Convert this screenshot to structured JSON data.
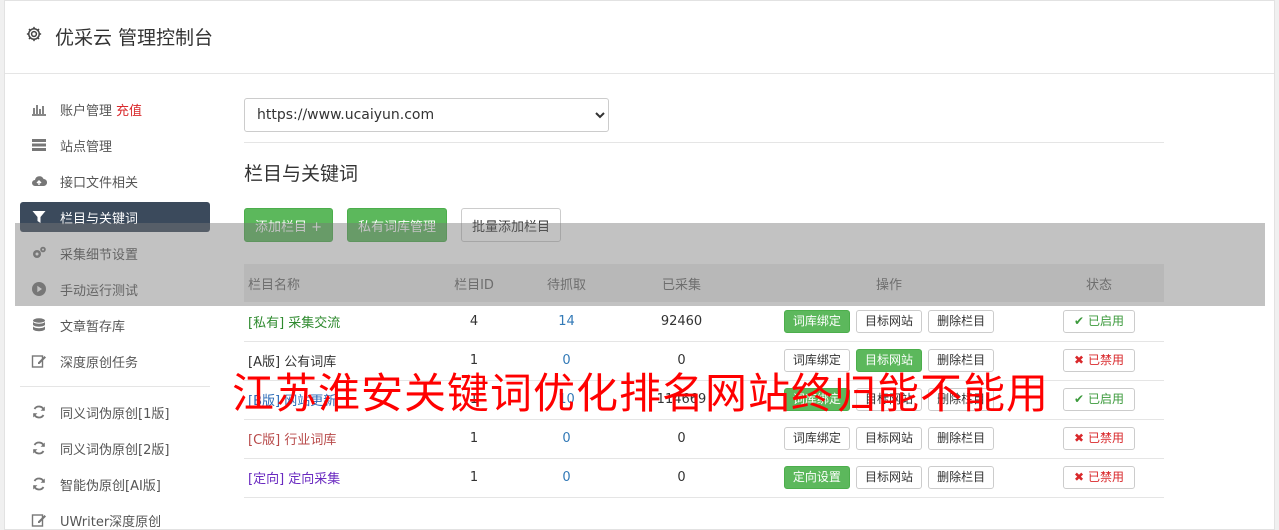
{
  "header": {
    "title": "优采云 管理控制台"
  },
  "sidebar": {
    "items": [
      {
        "label": "账户管理",
        "extra": "充值",
        "icon": "bar-chart-icon"
      },
      {
        "label": "站点管理",
        "icon": "server-icon"
      },
      {
        "label": "接口文件相关",
        "icon": "cloud-upload-icon"
      },
      {
        "label": "栏目与关键词",
        "icon": "filter-icon",
        "active": true
      },
      {
        "label": "采集细节设置",
        "icon": "cogs-icon"
      },
      {
        "label": "手动运行测试",
        "icon": "play-icon"
      },
      {
        "label": "文章暂存库",
        "icon": "database-icon"
      },
      {
        "label": "深度原创任务",
        "icon": "edit-icon"
      }
    ],
    "items2": [
      {
        "label": "同义词伪原创[1版]",
        "icon": "refresh-icon"
      },
      {
        "label": "同义词伪原创[2版]",
        "icon": "refresh-icon"
      },
      {
        "label": "智能伪原创[AI版]",
        "icon": "refresh-icon"
      },
      {
        "label": "UWriter深度原创",
        "icon": "edit-icon"
      }
    ]
  },
  "main": {
    "site_select": {
      "value": "https://www.ucaiyun.com"
    },
    "section_title": "栏目与关键词",
    "buttons": {
      "add": "添加栏目 +",
      "private_lib": "私有词库管理",
      "batch_add": "批量添加栏目"
    },
    "table": {
      "headers": [
        "栏目名称",
        "栏目ID",
        "待抓取",
        "已采集",
        "操作",
        "状态"
      ],
      "rows": [
        {
          "tag": "[私有]",
          "name": "采集交流",
          "id": "4",
          "pending": "14",
          "collected": "92460",
          "op1": "词库绑定",
          "op2": "目标网站",
          "op3": "删除栏目",
          "status": "已启用",
          "on": true
        },
        {
          "tag": "[A版]",
          "name": "公有词库",
          "id": "1",
          "pending": "0",
          "collected": "0",
          "op1": "词库绑定",
          "op2": "目标网站",
          "op3": "删除栏目",
          "status": "已禁用",
          "on": false
        },
        {
          "tag": "[B版]",
          "name": "网站更新",
          "id": "1",
          "pending": "10",
          "collected": "114669",
          "op1": "词库绑定",
          "op2": "目标网站",
          "op3": "删除栏目",
          "status": "已启用",
          "on": true
        },
        {
          "tag": "[C版]",
          "name": "行业词库",
          "id": "1",
          "pending": "0",
          "collected": "0",
          "op1": "词库绑定",
          "op2": "目标网站",
          "op3": "删除栏目",
          "status": "已禁用",
          "on": false
        },
        {
          "tag": "[定向]",
          "name": "定向采集",
          "id": "1",
          "pending": "0",
          "collected": "0",
          "op1": "定向设置",
          "op2": "目标网站",
          "op3": "删除栏目",
          "status": "已禁用",
          "on": false
        }
      ]
    }
  },
  "watermark": "江苏淮安关键词优化排名网站终归能不能用",
  "colors": {
    "accent": "#5cb85c",
    "active_nav": "#3b4a5c",
    "watermark": "#ff0000"
  }
}
